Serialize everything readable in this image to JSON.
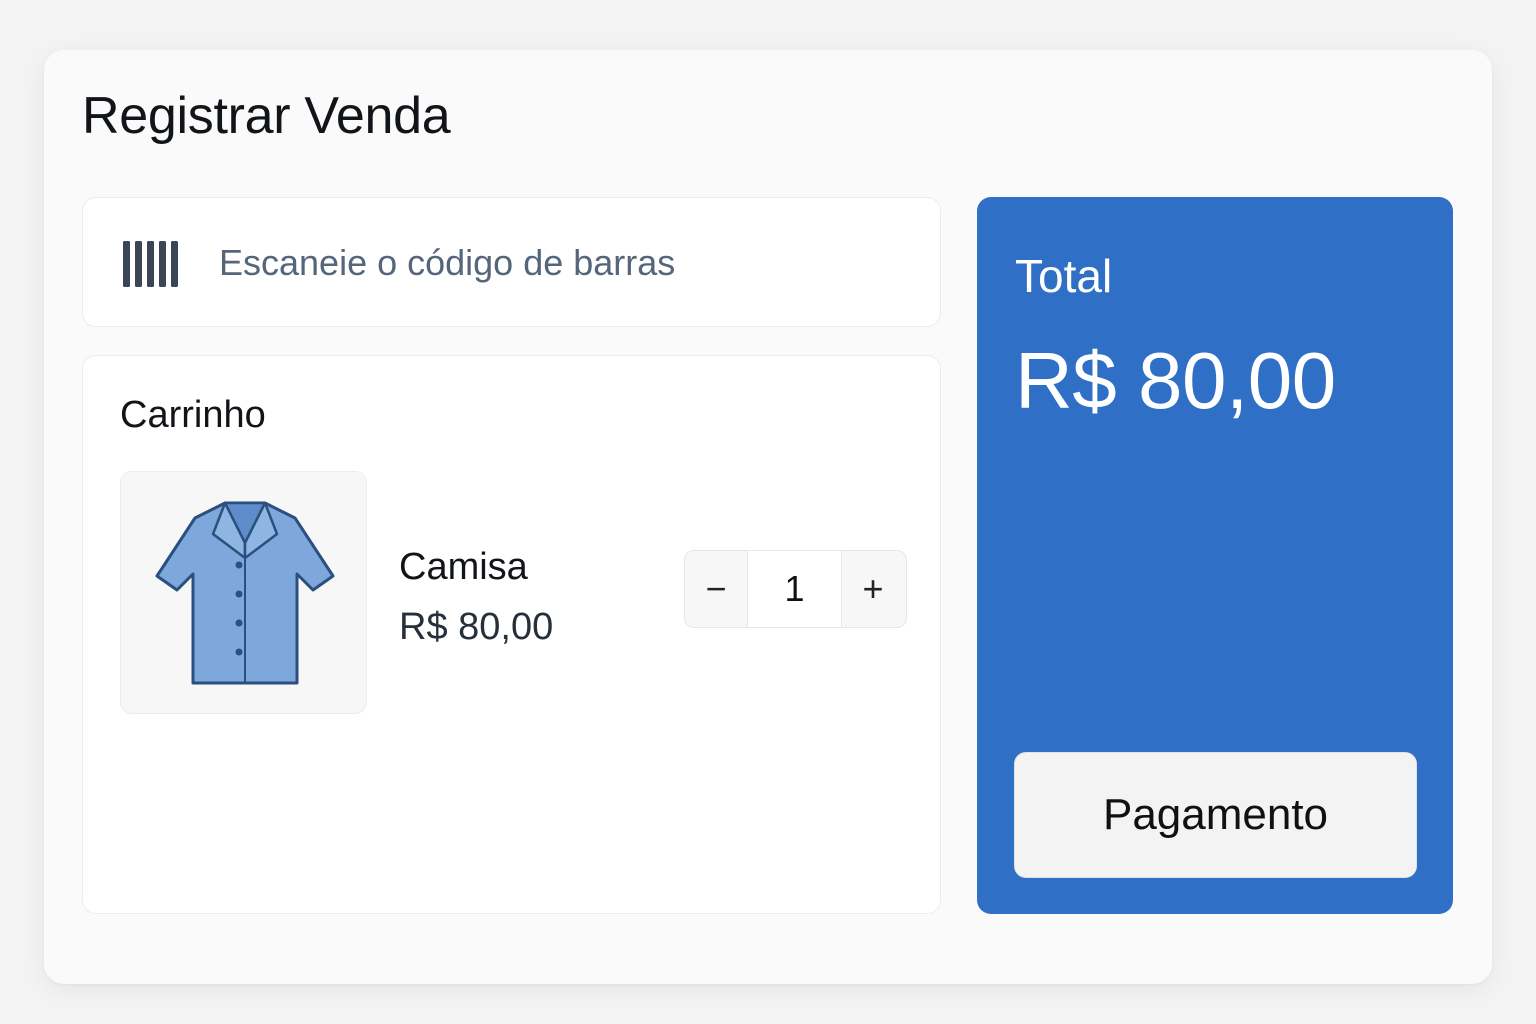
{
  "page": {
    "title": "Registrar Venda"
  },
  "scanner": {
    "placeholder": "Escaneie o código de barras",
    "icon": "barcode-icon"
  },
  "cart": {
    "title": "Carrinho",
    "items": [
      {
        "name": "Camisa",
        "price": "R$ 80,00",
        "quantity": "1",
        "image_icon": "shirt-icon"
      }
    ],
    "decrement_label": "−",
    "increment_label": "+"
  },
  "summary": {
    "total_label": "Total",
    "total_value": "R$ 80,00",
    "payment_button": "Pagamento"
  },
  "colors": {
    "accent": "#2f6fc6",
    "shirt_fill": "#7ea8db",
    "shirt_stroke": "#2b4f7e"
  }
}
